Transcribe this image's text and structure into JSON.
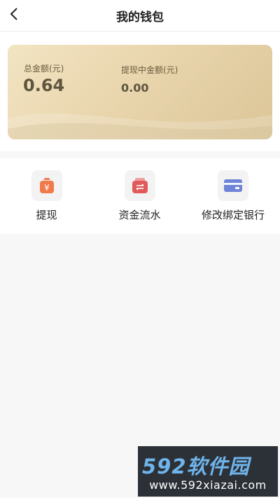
{
  "header": {
    "title": "我的钱包",
    "back_icon": "chevron-left-icon"
  },
  "wallet": {
    "total_label": "总金额(元)",
    "total_value": "0.64",
    "pending_label": "提现中金额(元)",
    "pending_value": "0.00"
  },
  "menu": {
    "items": [
      {
        "label": "提现",
        "icon": "money-bag-icon",
        "color": "#f07a4a"
      },
      {
        "label": "资金流水",
        "icon": "transfer-icon",
        "color": "#e05a5a"
      },
      {
        "label": "修改绑定银行",
        "icon": "bank-card-icon",
        "color": "#6f83d8"
      }
    ]
  },
  "watermark": {
    "brand": "592软件园",
    "url": "www.592xiazai.com"
  },
  "colors": {
    "card_gold": "#e8d4ab",
    "background": "#f7f7f7",
    "watermark_bg": "#2c3138"
  }
}
